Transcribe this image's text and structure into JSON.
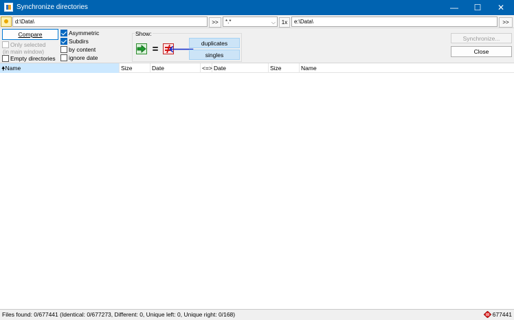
{
  "window": {
    "title": "Synchronize directories",
    "minimize_glyph": "—",
    "maximize_glyph": "☐",
    "close_glyph": "✕"
  },
  "paths": {
    "left_path": "d:\\Data\\",
    "left_browse": ">>",
    "mask": "*.*",
    "mask_arrow": "⌵",
    "one_x": "1x",
    "right_path": "e:\\Data\\",
    "right_browse": ">>"
  },
  "options": {
    "compare_label": "Compare",
    "only_selected_label": "Only selected",
    "in_main_window_label": "(in main window)",
    "empty_directories_label": "Empty directories",
    "asymmetric_label": "Asymmetric",
    "subdirs_label": "Subdirs",
    "by_content_label": "by content",
    "ignore_date_label": "ignore date",
    "checks": {
      "only_selected": false,
      "empty_directories": false,
      "asymmetric": true,
      "subdirs": true,
      "by_content": false,
      "ignore_date": false
    }
  },
  "show": {
    "label": "Show:",
    "equal_glyph": "=",
    "left_arrow_glyph": "🡐",
    "duplicates_label": "duplicates",
    "singles_label": "singles"
  },
  "actions": {
    "synchronize_label": "Synchronize...",
    "close_label": "Close"
  },
  "columns": {
    "name_left": "Name",
    "sort_glyph": "🠝",
    "size_left": "Size",
    "date_left": "Date",
    "compare": "<=>",
    "date_right": "Date",
    "size_right": "Size",
    "name_right": "Name"
  },
  "status": {
    "text": "Files found: 0/677441  (Identical: 0/677273, Different: 0, Unique left: 0, Unique right: 0/168)",
    "count": "677441"
  },
  "colors": {
    "titlebar": "#0063b1",
    "accent": "#0067c0",
    "toggle_on": "#cce4f7",
    "sorted_column": "#cce8ff"
  }
}
